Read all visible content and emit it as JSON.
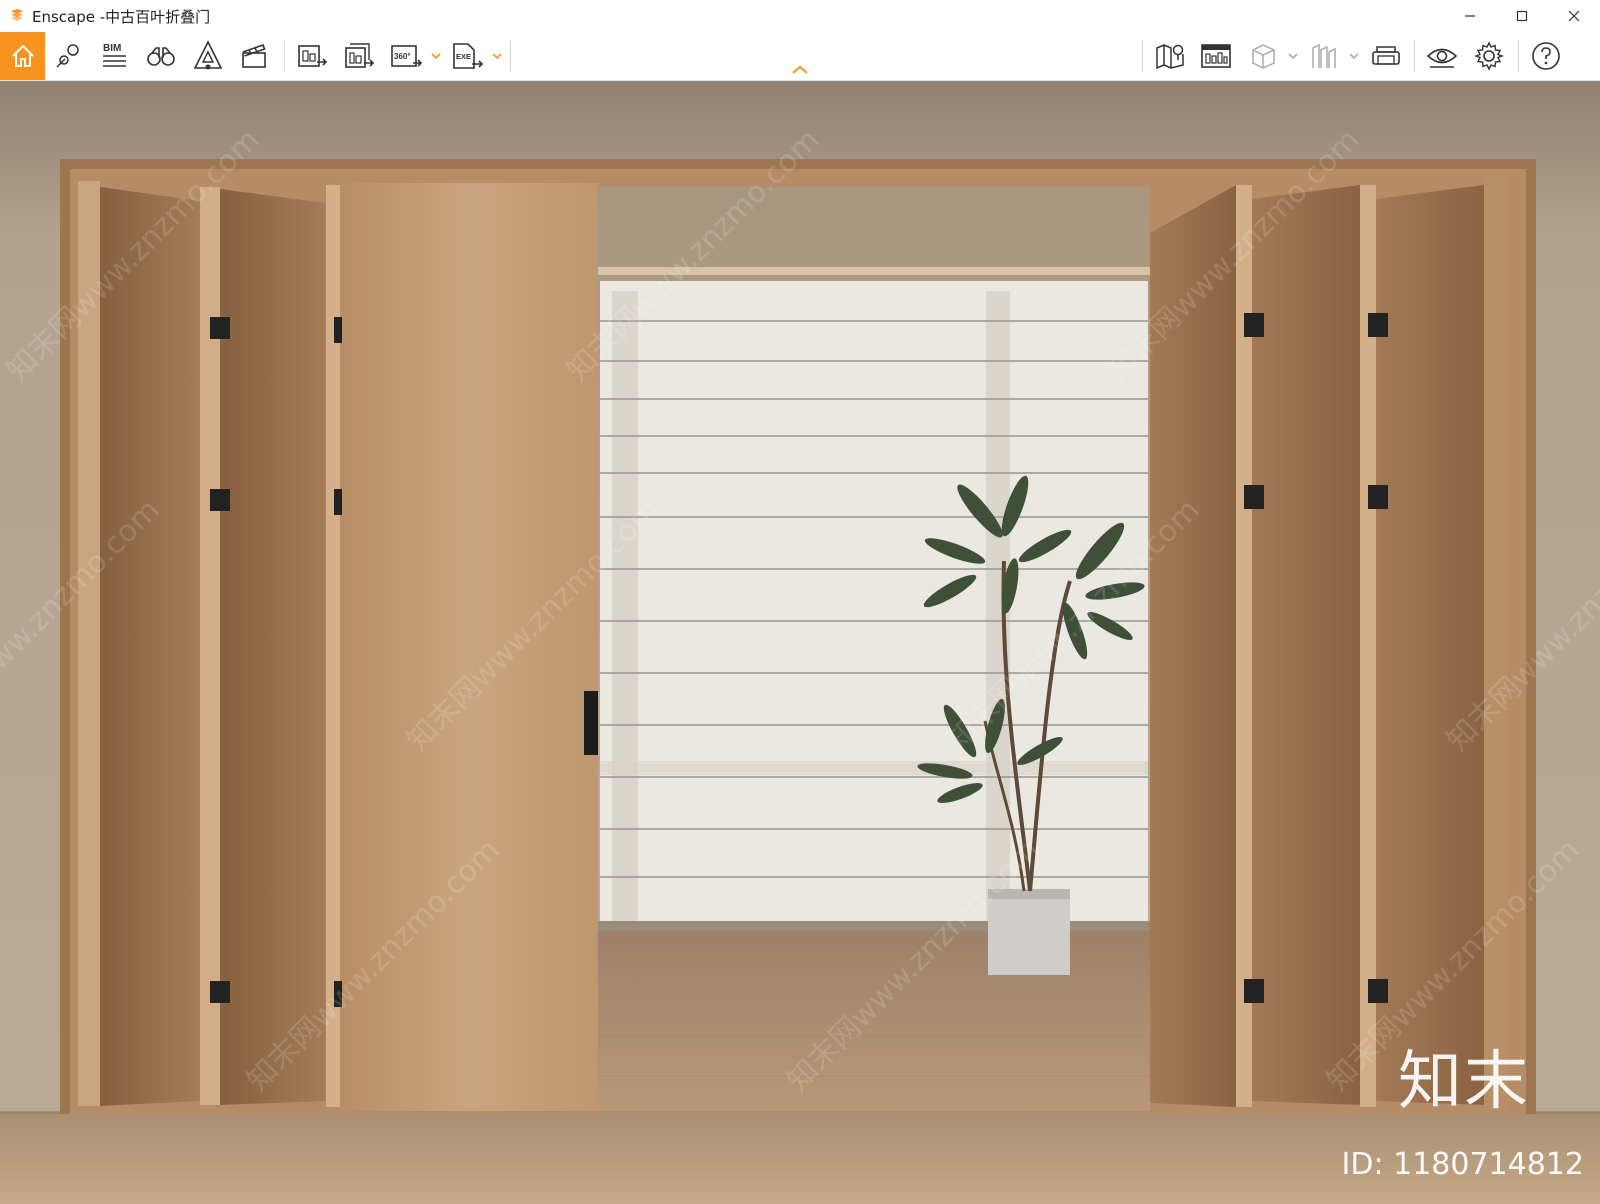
{
  "window": {
    "app_name": "Enscape",
    "title": "Enscape -中古百叶折叠门",
    "controls": [
      "minimize",
      "maximize",
      "close"
    ]
  },
  "toolbar": {
    "left_buttons": [
      {
        "name": "home",
        "icon": "home-icon"
      },
      {
        "name": "views",
        "icon": "map-pin-icon"
      },
      {
        "name": "bim",
        "icon": "bim-icon",
        "label": "BIM"
      },
      {
        "name": "binoculars",
        "icon": "binoculars-icon"
      },
      {
        "name": "assets",
        "icon": "asset-library-icon"
      },
      {
        "name": "video",
        "icon": "clapperboard-icon"
      },
      {
        "name": "screenshot",
        "icon": "render-image-icon"
      },
      {
        "name": "batch-render",
        "icon": "batch-render-icon"
      },
      {
        "name": "panorama",
        "icon": "panorama-icon",
        "label": "360°"
      },
      {
        "name": "export-exe",
        "icon": "export-exe-icon",
        "label": "EXE"
      }
    ],
    "right_buttons": [
      {
        "name": "map",
        "icon": "map-icon"
      },
      {
        "name": "material-editor",
        "icon": "material-editor-icon"
      },
      {
        "name": "collaborate",
        "icon": "cube-icon"
      },
      {
        "name": "bim-filter",
        "icon": "building-icon"
      },
      {
        "name": "vr",
        "icon": "vr-headset-icon"
      },
      {
        "name": "visual-settings",
        "icon": "eye-icon"
      },
      {
        "name": "settings",
        "icon": "gear-icon"
      },
      {
        "name": "help",
        "icon": "help-icon"
      }
    ],
    "accent_color": "#f7931e"
  },
  "viewport": {
    "watermark_text": "知末网www.znzmo.com",
    "brand_logo": "知末",
    "image_id": "ID: 1180714812"
  },
  "colors": {
    "wall": "#b8a791",
    "wood": "#c8a47d",
    "floor": "#bb9a7a",
    "blind": "#ece9e3"
  }
}
